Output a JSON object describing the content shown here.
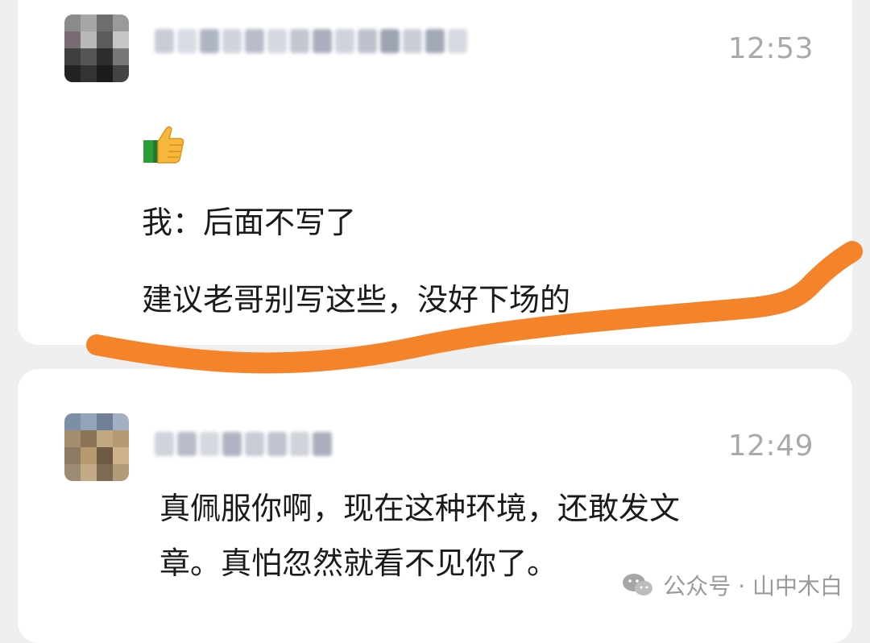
{
  "messages": [
    {
      "time": "12:53",
      "emoji": "thumbs-up-icon",
      "lines": [
        "我：后面不写了",
        "建议老哥别写这些，没好下场的"
      ]
    },
    {
      "time": "12:49",
      "lines": [
        "真佩服你啊，现在这种环境，还敢发文",
        "章。真怕忽然就看不见你了。"
      ]
    }
  ],
  "watermark": {
    "text": "公众号 · 山中木白"
  },
  "colors": {
    "highlight": "#f5832a",
    "time_text": "#a9a9a9",
    "card_bg": "#ffffff",
    "page_bg": "#efefef"
  }
}
